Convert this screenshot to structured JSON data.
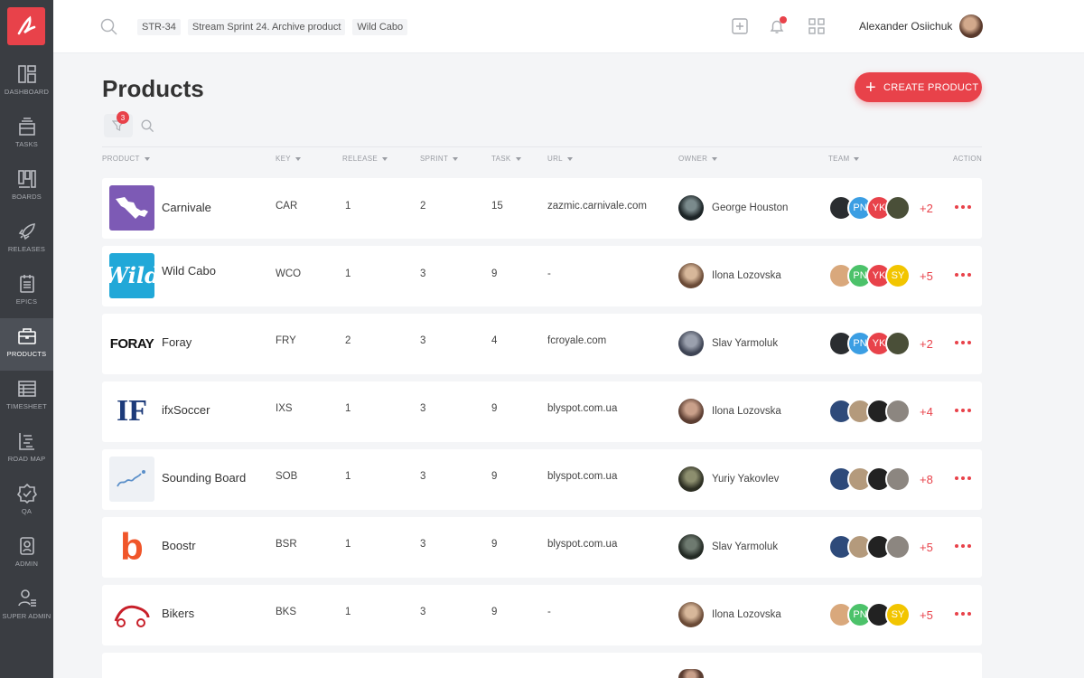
{
  "header": {
    "breadcrumbs": [
      "STR-34",
      "Stream Sprint 24. Archive product",
      "Wild Cabo"
    ],
    "user_name": "Alexander Osiichuk"
  },
  "sidebar": {
    "items": [
      {
        "label": "DASHBOARD",
        "icon": "dashboard-icon"
      },
      {
        "label": "TASKS",
        "icon": "tasks-icon"
      },
      {
        "label": "BOARDS",
        "icon": "boards-icon"
      },
      {
        "label": "RELEASES",
        "icon": "rocket-icon"
      },
      {
        "label": "EPICS",
        "icon": "epics-icon"
      },
      {
        "label": "PRODUCTS",
        "icon": "briefcase-icon",
        "active": true
      },
      {
        "label": "TIMESHEET",
        "icon": "timesheet-icon"
      },
      {
        "label": "ROAD MAP",
        "icon": "roadmap-icon"
      },
      {
        "label": "QA",
        "icon": "shield-check-icon"
      },
      {
        "label": "ADMIN",
        "icon": "admin-icon"
      },
      {
        "label": "SUPER ADMIN",
        "icon": "super-admin-icon"
      }
    ]
  },
  "main": {
    "title": "Products",
    "create_label": "CREATE PRODUCT",
    "filter_count": "3",
    "columns": [
      "PRODUCT",
      "KEY",
      "RELEASE",
      "SPRINT",
      "TASK",
      "URL",
      "OWNER",
      "TEAM",
      "ACTION"
    ]
  },
  "rows": [
    {
      "name": "Carnivale",
      "logo_text": "",
      "key": "CAR",
      "release": "1",
      "sprint": "2",
      "task": "15",
      "url": "zazmic.carnivale.com",
      "owner": "George Houston",
      "team": [
        "",
        "PN",
        "YK",
        ""
      ],
      "more": "+2"
    },
    {
      "name": "Wild Cabo",
      "logo_text": "Wild",
      "key": "WCO",
      "release": "1",
      "sprint": "3",
      "task": "9",
      "url": "-",
      "owner": "Ilona Lozovska",
      "team": [
        "",
        "PN",
        "YK",
        "SY"
      ],
      "more": "+5"
    },
    {
      "name": "Foray",
      "logo_text": "FORAY",
      "key": "FRY",
      "release": "2",
      "sprint": "3",
      "task": "4",
      "url": "fcroyale.com",
      "owner": "Slav Yarmoluk",
      "team": [
        "",
        "PN",
        "YK",
        ""
      ],
      "more": "+2"
    },
    {
      "name": "ifxSoccer",
      "logo_text": "IF",
      "key": "IXS",
      "release": "1",
      "sprint": "3",
      "task": "9",
      "url": "blyspot.com.ua",
      "owner": "Ilona Lozovska",
      "team": [
        "",
        "",
        "",
        ""
      ],
      "more": "+4"
    },
    {
      "name": "Sounding Board",
      "logo_text": "",
      "key": "SOB",
      "release": "1",
      "sprint": "3",
      "task": "9",
      "url": "blyspot.com.ua",
      "owner": "Yuriy Yakovlev",
      "team": [
        "",
        "",
        "",
        ""
      ],
      "more": "+8"
    },
    {
      "name": "Boostr",
      "logo_text": "b",
      "key": "BSR",
      "release": "1",
      "sprint": "3",
      "task": "9",
      "url": "blyspot.com.ua",
      "owner": "Slav Yarmoluk",
      "team": [
        "",
        "",
        "",
        ""
      ],
      "more": "+5"
    },
    {
      "name": "Bikers",
      "logo_text": "",
      "key": "BKS",
      "release": "1",
      "sprint": "3",
      "task": "9",
      "url": "-",
      "owner": "Ilona Lozovska",
      "team": [
        "",
        "PN",
        "",
        "SY"
      ],
      "more": "+5"
    }
  ],
  "colors": {
    "accent": "#e8424a",
    "sidebar": "#3a3d42",
    "pn": "#3b9ee3",
    "yk": "#e8424a",
    "sy": "#f2c500"
  }
}
